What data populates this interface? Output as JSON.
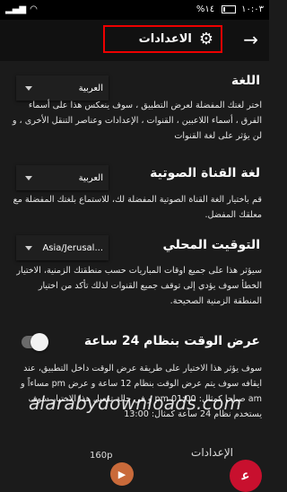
{
  "status_bar": {
    "time": "١٠:٠٣",
    "battery": "%١٤"
  },
  "header": {
    "title": "الاعدادات",
    "back_icon": "arrow-right-icon",
    "settings_icon": "gear-icon"
  },
  "sections": [
    {
      "title": "اللغة",
      "control": "dropdown",
      "value": "العربية",
      "description": "اختر لغتك المفضلة لعرض التطبيق ، سوف ينعكس هذا على أسماء الفرق ، أسماء اللاعبين ، القنوات ، الإعدادات وعناصر التنقل الأخرى ، و لن يؤثر على لغة القنوات"
    },
    {
      "title": "لغة القناة الصوتية",
      "control": "dropdown",
      "value": "العربية",
      "description": "قم باختيار الغة القناة الصوتية المفضلة لك، للاستماع بلغتك المفضلة مع معلقك المفضل."
    },
    {
      "title": "التوقيت المحلي",
      "control": "dropdown",
      "value": "Asia/Jerusal...",
      "description": "سيؤثر هذا على جميع اوقات المباريات حسب منطقتك الزمنية، الاختيار الخطأ سوف يؤدي إلى توقف جميع القنوات لذلك تأكد من اختيار المنطقة الزمنية الصحيحة."
    },
    {
      "title": "عرض الوقت بنظام 24 ساعة",
      "control": "toggle",
      "toggle_on": false,
      "description": "سوف يؤثر هذا الاختيار على طريقة عرض الوقت داخل التطبيق، عند ايقافه سوف يتم عرض الوقت بنظام 12 ساعة و عرض pm مساءاً و am صباحا كمثال: 01:00 pm و في حالة تفعيل هذا الاختيار سوف يستخدم نظام 24 ساعة كمثال: 13:00"
    }
  ],
  "bottom_partial": {
    "label": "الإعدادات",
    "value": "160p"
  },
  "watermark": "alarabydownloads.com",
  "logo": {
    "text": "ﻋ"
  }
}
